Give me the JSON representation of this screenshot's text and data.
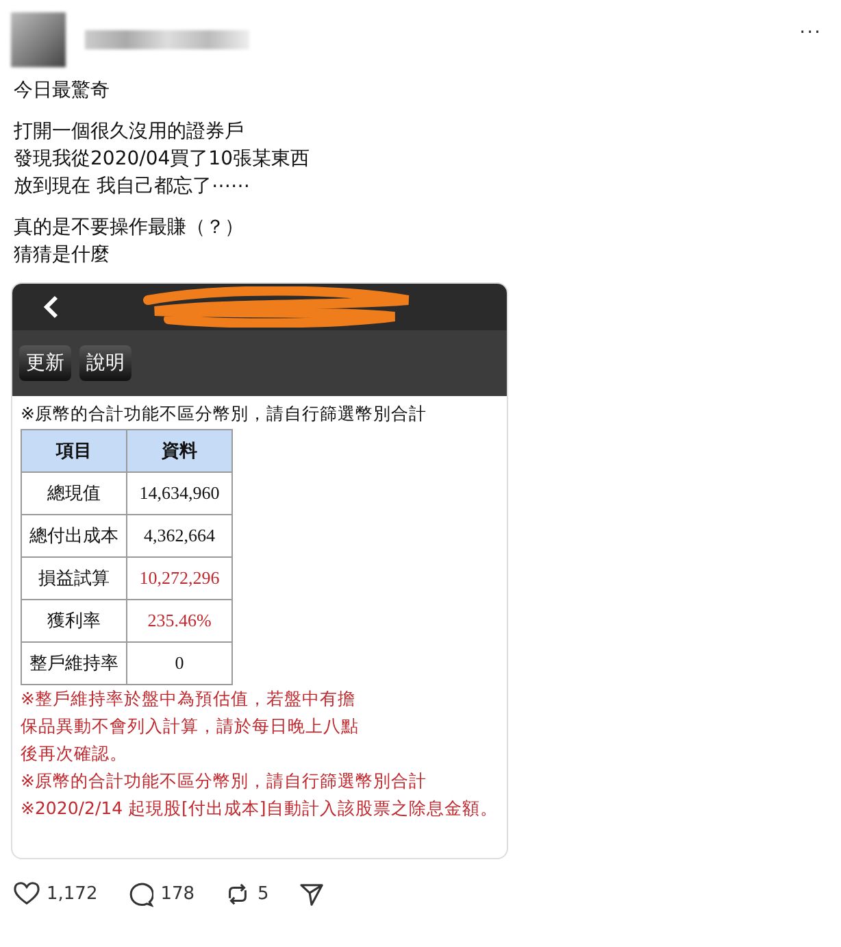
{
  "post": {
    "paragraphs": [
      [
        "今日最驚奇"
      ],
      [
        "打開一個很久沒用的證券戶",
        "發現我從2020/04買了10張某東西",
        "放到現在 我自己都忘了⋯⋯"
      ],
      [
        "真的是不要操作最賺（？）",
        "猜猜是什麼"
      ]
    ],
    "more": "···",
    "app": {
      "buttons": [
        "更新",
        "說明"
      ],
      "notice": "※原幣的合計功能不區分幣別，請自行篩選幣別合計",
      "table": {
        "columns": [
          "項目",
          "資料"
        ],
        "rows": [
          {
            "label": "總現值",
            "value": "14,634,960",
            "kind": "normal"
          },
          {
            "label": "總付出成本",
            "value": "4,362,664",
            "kind": "normal"
          },
          {
            "label": "損益試算",
            "value": "10,272,296",
            "kind": "profit"
          },
          {
            "label": "獲利率",
            "value": "235.46%",
            "kind": "profit"
          },
          {
            "label": "整戶維持率",
            "value": "0",
            "kind": "normal"
          }
        ]
      },
      "notes": [
        [
          "※整戶維持率於盤中為預估值，若盤中有擔",
          "保品異動不會列入計算，請於每日晚上八點",
          "後再次確認。"
        ],
        [
          "※原幣的合計功能不區分幣別，請自行篩選幣別合計"
        ],
        [
          "※2020/2/14 起現股[付出成本]自動計入該股票之除息金額。"
        ]
      ]
    },
    "actions": [
      {
        "kind": "like",
        "count": "1,172"
      },
      {
        "kind": "reply",
        "count": "178"
      },
      {
        "kind": "repost",
        "count": "5"
      },
      {
        "kind": "share"
      }
    ]
  }
}
